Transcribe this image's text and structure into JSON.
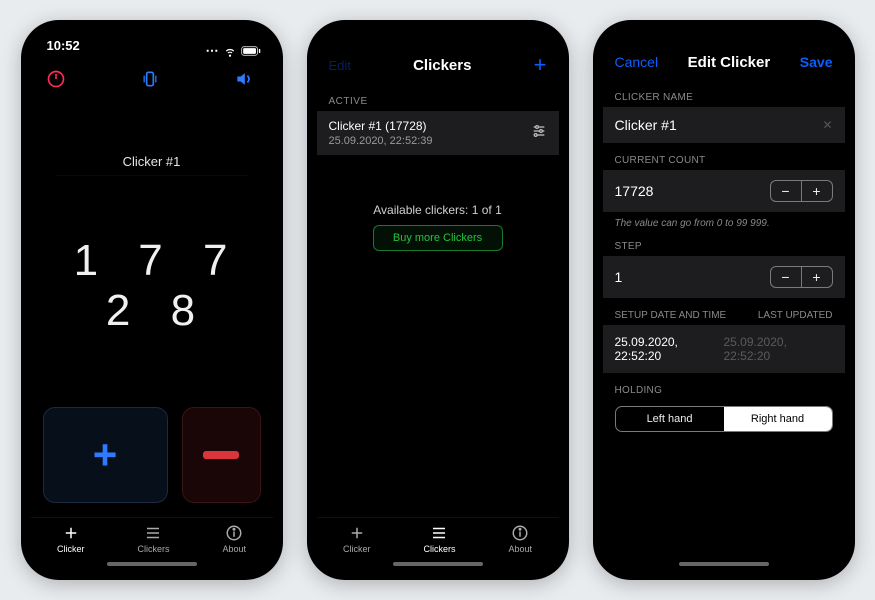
{
  "screen1": {
    "time": "10:52",
    "clicker_title": "Clicker #1",
    "count": "1 7 7 2 8",
    "tabs": {
      "clicker": "Clicker",
      "clickers": "Clickers",
      "about": "About"
    }
  },
  "screen2": {
    "nav_edit": "Edit",
    "nav_title": "Clickers",
    "section_active": "ACTIVE",
    "active_row": {
      "title": "Clicker #1 (17728)",
      "subtitle": "25.09.2020, 22:52:39"
    },
    "available_text": "Available clickers: 1 of 1",
    "buy_more": "Buy more Clickers",
    "tabs": {
      "clicker": "Clicker",
      "clickers": "Clickers",
      "about": "About"
    }
  },
  "screen3": {
    "nav_cancel": "Cancel",
    "nav_title": "Edit Clicker",
    "nav_save": "Save",
    "label_name": "CLICKER NAME",
    "name_value": "Clicker #1",
    "label_count": "CURRENT COUNT",
    "count_value": "17728",
    "count_hint": "The value can go from 0 to 99 999.",
    "label_step": "STEP",
    "step_value": "1",
    "label_setup": "SETUP DATE AND TIME",
    "label_updated": "LAST UPDATED",
    "setup_value": "25.09.2020, 22:52:20",
    "updated_value": "25.09.2020, 22:52:20",
    "label_holding": "HOLDING",
    "seg_left": "Left hand",
    "seg_right": "Right hand"
  }
}
